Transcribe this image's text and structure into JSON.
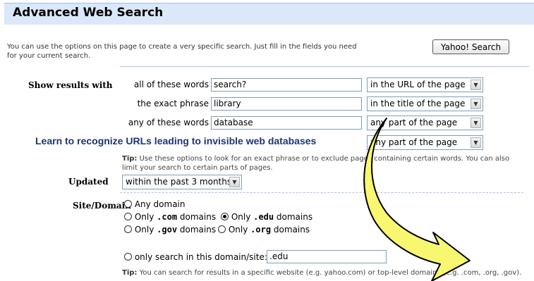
{
  "header": {
    "title": "Advanced Web Search"
  },
  "intro": {
    "text": "You can use the options on this page to create a very specific search. Just fill in the fields you need for your current search."
  },
  "toolbar": {
    "search_button": "Yahoo! Search"
  },
  "show_results": {
    "label": "Show results with",
    "rows": [
      {
        "label": "all of these words",
        "value": "search?",
        "where": "in the URL of the page"
      },
      {
        "label": "the exact phrase",
        "value": "library",
        "where": "in the title of the page"
      },
      {
        "label": "any of these words",
        "value": "database",
        "where": "any part of the page"
      },
      {
        "label": "",
        "value": "",
        "where": "any part of the page"
      }
    ],
    "tip_label": "Tip:",
    "tip": "Use these options to look for an exact phrase or to exclude pages containing certain words. You can also limit your search to certain parts of pages."
  },
  "updated": {
    "label": "Updated",
    "value": "within the past 3 months"
  },
  "site_domain": {
    "label": "Site/Domain",
    "any": "Any domain",
    "only": "Only",
    "domains": "domains",
    "com": ".com",
    "edu": ".edu",
    "gov": ".gov",
    "org": ".org",
    "only_search_label": "only search in this domain/site:",
    "only_search_value": ".edu",
    "tip_label": "Tip:",
    "tip": "You can search for results in a specific website (e.g. yahoo.com) or top-level domains (e.g. .com, .org, .gov)."
  },
  "annotation": {
    "text": "Learn to recognize URLs leading to invisible web databases"
  },
  "colors": {
    "header_bg": "#dbe8f9",
    "annotation": "#1f3570",
    "arrow_fill": "#f8f870"
  }
}
